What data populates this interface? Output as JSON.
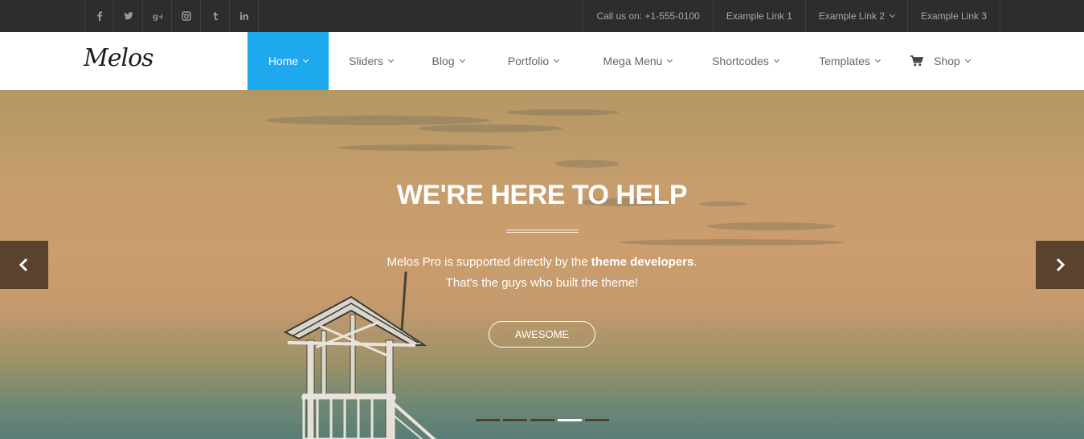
{
  "topbar": {
    "social": [
      {
        "icon": "facebook-icon",
        "glyph": "f"
      },
      {
        "icon": "twitter-icon",
        "glyph": "t"
      },
      {
        "icon": "google-plus-icon",
        "glyph": "g+"
      },
      {
        "icon": "instagram-icon",
        "glyph": "ig"
      },
      {
        "icon": "tumblr-icon",
        "glyph": "t"
      },
      {
        "icon": "linkedin-icon",
        "glyph": "in"
      }
    ],
    "phone": "Call us on: +1-555-0100",
    "links": [
      {
        "label": "Example Link 1",
        "has_dropdown": false
      },
      {
        "label": "Example Link 2",
        "has_dropdown": true
      },
      {
        "label": "Example Link 3",
        "has_dropdown": false
      }
    ]
  },
  "header": {
    "logo": "Melos",
    "nav": [
      {
        "label": "Home",
        "active": true
      },
      {
        "label": "Sliders",
        "active": false
      },
      {
        "label": "Blog",
        "active": false
      },
      {
        "label": "Portfolio",
        "active": false
      },
      {
        "label": "Mega Menu",
        "active": false
      },
      {
        "label": "Shortcodes",
        "active": false
      },
      {
        "label": "Templates",
        "active": false
      },
      {
        "label": "Shop",
        "active": false,
        "icon": "cart-icon"
      }
    ],
    "accent_color": "#1ea8ee"
  },
  "hero": {
    "title": "WE'RE HERE TO HELP",
    "line1_prefix": "Melos Pro is supported directly by the ",
    "line1_bold": "theme developers",
    "line1_suffix": ".",
    "line2": "That's the guys who built the theme!",
    "button_label": "AWESOME",
    "prev_icon": "chevron-left-icon",
    "next_icon": "chevron-right-icon",
    "slide_count": 5,
    "active_slide": 4
  }
}
